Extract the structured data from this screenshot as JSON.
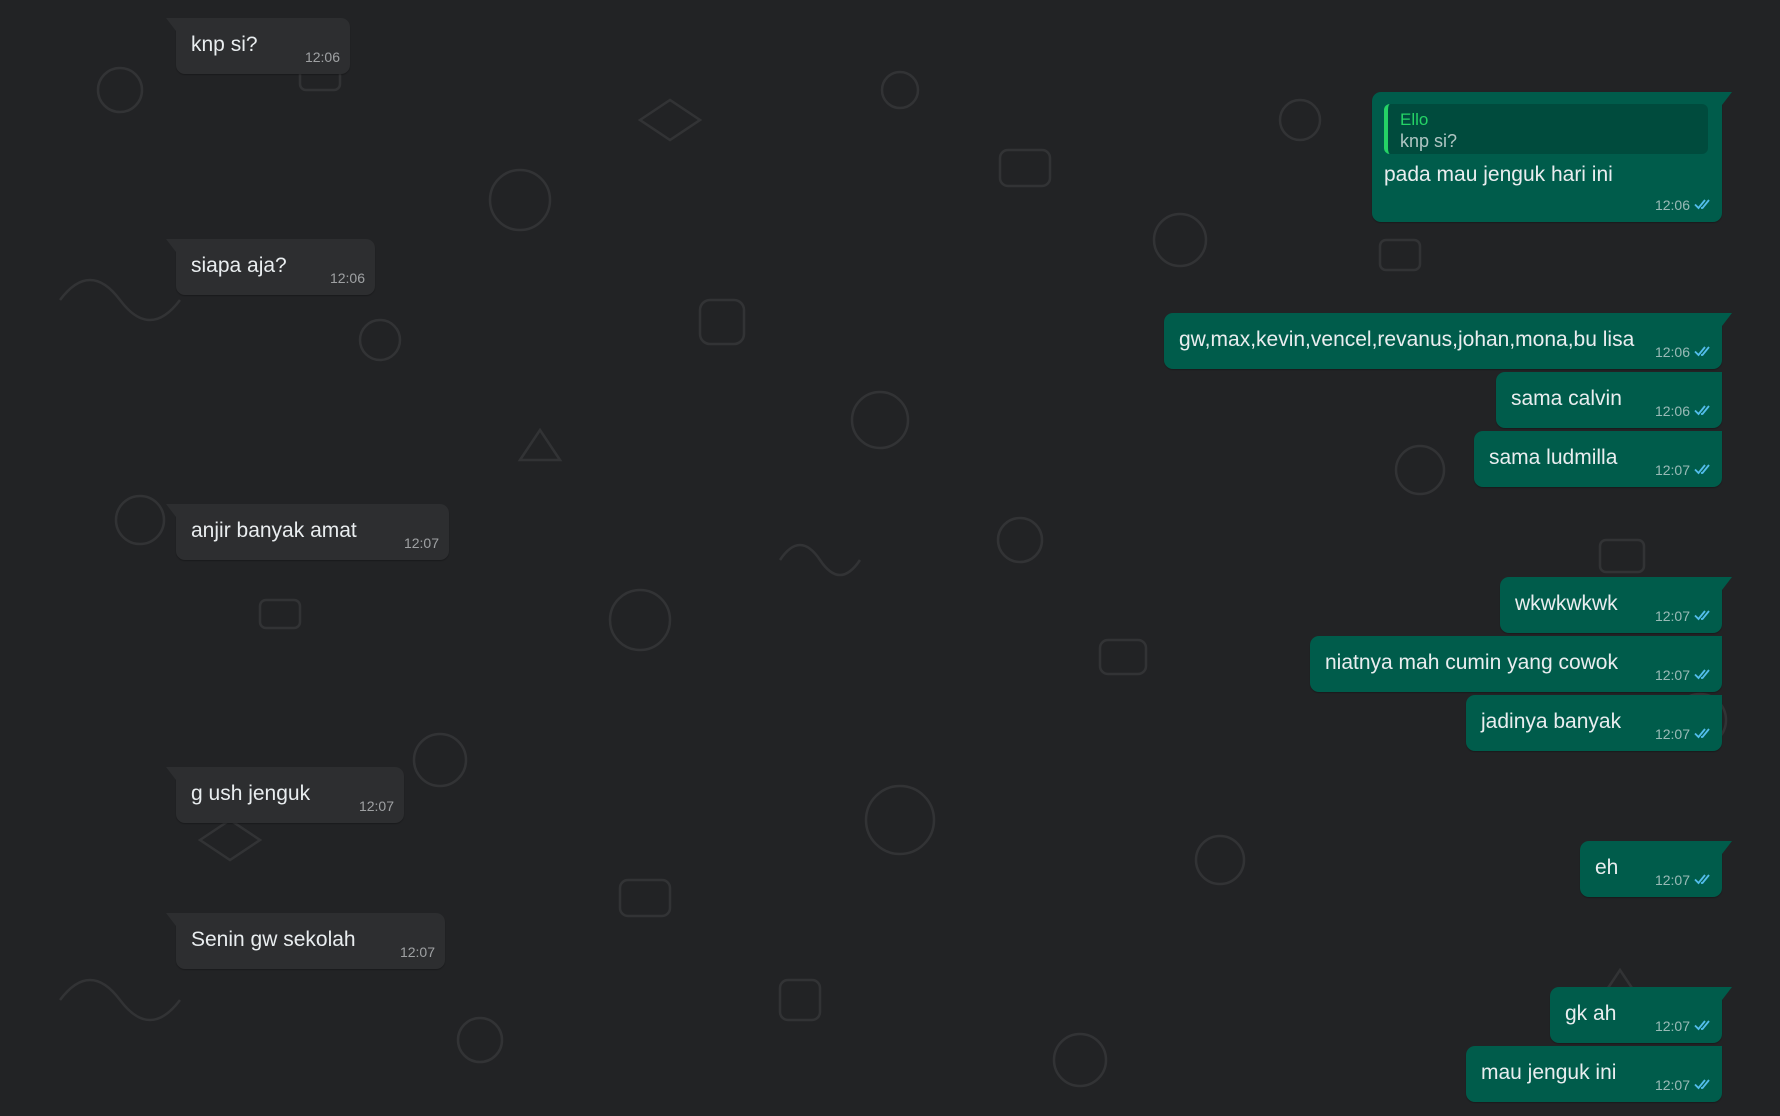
{
  "colors": {
    "background": "#222325",
    "incoming_bubble": "#2d2e30",
    "outgoing_bubble": "#005c4b",
    "read_ticks": "#53bdeb",
    "quote_accent": "#25d366"
  },
  "icons": {
    "read_receipt": "double-check-icon"
  },
  "messages": [
    {
      "direction": "in",
      "text": "knp si?",
      "time": "12:06"
    },
    {
      "direction": "out",
      "quote": {
        "author": "Ello",
        "text": "knp si?"
      },
      "text": "pada mau jenguk hari ini",
      "time": "12:06",
      "status": "read"
    },
    {
      "direction": "in",
      "text": "siapa aja?",
      "time": "12:06"
    },
    {
      "direction": "out",
      "text": "gw,max,kevin,vencel,revanus,johan,mona,bu lisa",
      "time": "12:06",
      "status": "read"
    },
    {
      "direction": "out",
      "text": "sama calvin",
      "time": "12:06",
      "status": "read"
    },
    {
      "direction": "out",
      "text": "sama ludmilla",
      "time": "12:07",
      "status": "read"
    },
    {
      "direction": "in",
      "text": "anjir banyak amat",
      "time": "12:07"
    },
    {
      "direction": "out",
      "text": "wkwkwkwk",
      "time": "12:07",
      "status": "read"
    },
    {
      "direction": "out",
      "text": "niatnya mah cumin yang cowok",
      "time": "12:07",
      "status": "read"
    },
    {
      "direction": "out",
      "text": "jadinya banyak",
      "time": "12:07",
      "status": "read"
    },
    {
      "direction": "in",
      "text": "g ush jenguk",
      "time": "12:07"
    },
    {
      "direction": "out",
      "text": "eh",
      "time": "12:07",
      "status": "read"
    },
    {
      "direction": "in",
      "text": "Senin gw sekolah",
      "time": "12:07"
    },
    {
      "direction": "out",
      "text": "gk ah",
      "time": "12:07",
      "status": "read"
    },
    {
      "direction": "out",
      "text": "mau jenguk ini",
      "time": "12:07",
      "status": "read"
    }
  ]
}
